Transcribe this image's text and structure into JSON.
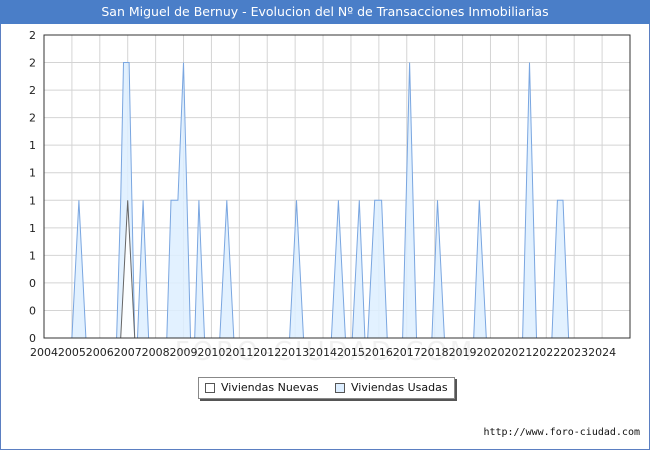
{
  "title": "San Miguel de Bernuy - Evolucion del Nº de Transacciones Inmobiliarias",
  "source": "http://www.foro-ciudad.com",
  "watermark": "FORO-CIUDAD.COM",
  "legend": {
    "nuevas": "Viviendas Nuevas",
    "usadas": "Viviendas Usadas"
  },
  "colors": {
    "title_bg": "#4a7ec8",
    "usadas_fill": "#ddeeff",
    "usadas_stroke": "#7aa6e0",
    "nuevas_fill": "#ffffff",
    "nuevas_stroke": "#666666",
    "grid": "#d4d4d4"
  },
  "chart_data": {
    "type": "area",
    "ylim": [
      0,
      2.2
    ],
    "y_tick_values": [
      0,
      0.2,
      0.4,
      0.6,
      0.8,
      1.0,
      1.2,
      1.4,
      1.6,
      1.8,
      2.0,
      2.2
    ],
    "y_tick_labels": [
      "0",
      "0",
      "0",
      "1",
      "1",
      "1",
      "1",
      "1",
      "2",
      "2",
      "2",
      "2"
    ],
    "x_tick_labels": [
      "2004",
      "2005",
      "2006",
      "2007",
      "2008",
      "2009",
      "2010",
      "2011",
      "2012",
      "2013",
      "2014",
      "2015",
      "2016",
      "2017",
      "2018",
      "2019",
      "2020",
      "2021",
      "2022",
      "2023",
      "2024"
    ],
    "xlim": [
      2004,
      2025
    ],
    "grid": true,
    "legend_position": "bottom-center",
    "series": [
      {
        "name": "Viviendas Usadas",
        "points": [
          [
            2004.0,
            0
          ],
          [
            2005.0,
            0
          ],
          [
            2005.25,
            1
          ],
          [
            2005.5,
            0
          ],
          [
            2006.6,
            0
          ],
          [
            2006.75,
            1
          ],
          [
            2006.85,
            2
          ],
          [
            2007.05,
            2
          ],
          [
            2007.25,
            0
          ],
          [
            2007.35,
            0
          ],
          [
            2007.55,
            1
          ],
          [
            2007.75,
            0
          ],
          [
            2008.4,
            0
          ],
          [
            2008.55,
            1
          ],
          [
            2008.8,
            1
          ],
          [
            2009.0,
            2
          ],
          [
            2009.25,
            0
          ],
          [
            2009.4,
            0
          ],
          [
            2009.55,
            1
          ],
          [
            2009.75,
            0
          ],
          [
            2010.3,
            0
          ],
          [
            2010.55,
            1
          ],
          [
            2010.8,
            0
          ],
          [
            2012.8,
            0
          ],
          [
            2013.05,
            1
          ],
          [
            2013.3,
            0
          ],
          [
            2014.3,
            0
          ],
          [
            2014.55,
            1
          ],
          [
            2014.8,
            0
          ],
          [
            2015.05,
            0
          ],
          [
            2015.3,
            1
          ],
          [
            2015.5,
            0
          ],
          [
            2015.6,
            0
          ],
          [
            2015.85,
            1
          ],
          [
            2016.1,
            1
          ],
          [
            2016.3,
            0
          ],
          [
            2016.85,
            0
          ],
          [
            2017.1,
            2
          ],
          [
            2017.35,
            0
          ],
          [
            2017.9,
            0
          ],
          [
            2018.1,
            1
          ],
          [
            2018.35,
            0
          ],
          [
            2019.4,
            0
          ],
          [
            2019.6,
            1
          ],
          [
            2019.85,
            0
          ],
          [
            2021.15,
            0
          ],
          [
            2021.4,
            2
          ],
          [
            2021.65,
            0
          ],
          [
            2022.2,
            0
          ],
          [
            2022.4,
            1
          ],
          [
            2022.6,
            1
          ],
          [
            2022.8,
            0
          ],
          [
            2025.0,
            0
          ]
        ]
      },
      {
        "name": "Viviendas Nuevas",
        "points": [
          [
            2004.0,
            0
          ],
          [
            2006.75,
            0
          ],
          [
            2007.0,
            1
          ],
          [
            2007.25,
            0
          ],
          [
            2025.0,
            0
          ]
        ]
      }
    ]
  }
}
